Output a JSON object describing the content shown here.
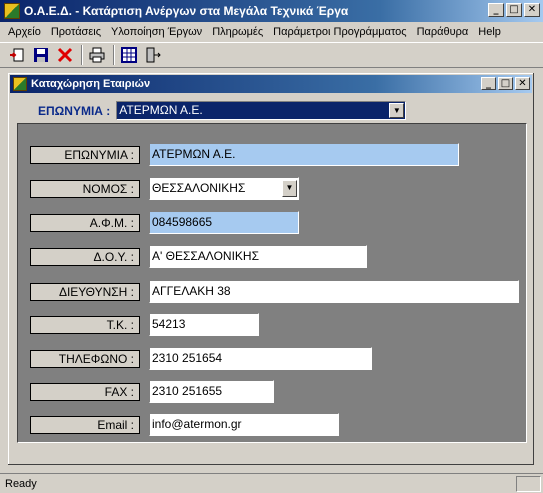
{
  "app": {
    "title": "Ο.Α.Ε.Δ. - Κατάρτιση Ανέργων στα Μεγάλα Τεχνικά Έργα",
    "window_buttons": {
      "minimize": "_",
      "maximize": "□",
      "close": "✕"
    }
  },
  "menu": {
    "items": [
      "Αρχείο",
      "Προτάσεις",
      "Υλοποίηση Έργων",
      "Πληρωμές",
      "Παράμετροι Προγράμματος",
      "Παράθυρα",
      "Help"
    ]
  },
  "toolbar": {
    "buttons": [
      "new-record-icon",
      "save-icon",
      "delete-icon",
      "print-icon",
      "grid-icon",
      "exit-icon"
    ]
  },
  "child_window": {
    "title": "Καταχώρηση Εταιριών",
    "company_selector_label": "ΕΠΩΝΥΜΙΑ :",
    "company_selector_value": "ΑΤΕΡΜΩΝ Α.Ε."
  },
  "form": {
    "fields": [
      {
        "label": "ΕΠΩΝΥΜΙΑ :",
        "value": "ΑΤΕΡΜΩΝ Α.Ε."
      },
      {
        "label": "ΝΟΜΟΣ :",
        "value": "ΘΕΣΣΑΛΟΝΙΚΗΣ"
      },
      {
        "label": "Α.Φ.Μ. :",
        "value": "084598665"
      },
      {
        "label": "Δ.Ο.Υ. :",
        "value": "Α' ΘΕΣΣΑΛΟΝΙΚΗΣ"
      },
      {
        "label": "ΔΙΕΥΘΥΝΣΗ :",
        "value": "ΑΓΓΕΛΑΚΗ 38"
      },
      {
        "label": "Τ.Κ. :",
        "value": "54213"
      },
      {
        "label": "ΤΗΛΕΦΩΝΟ :",
        "value": "2310 251654"
      },
      {
        "label": "FAX :",
        "value": "2310 251655"
      },
      {
        "label": "Email :",
        "value": "info@atermon.gr"
      }
    ]
  },
  "status": {
    "text": "Ready"
  },
  "colors": {
    "titlebar": "#0a246a",
    "panel": "#808080",
    "highlight_field": "#a6caf0",
    "label_text": "#0a2a8a"
  }
}
